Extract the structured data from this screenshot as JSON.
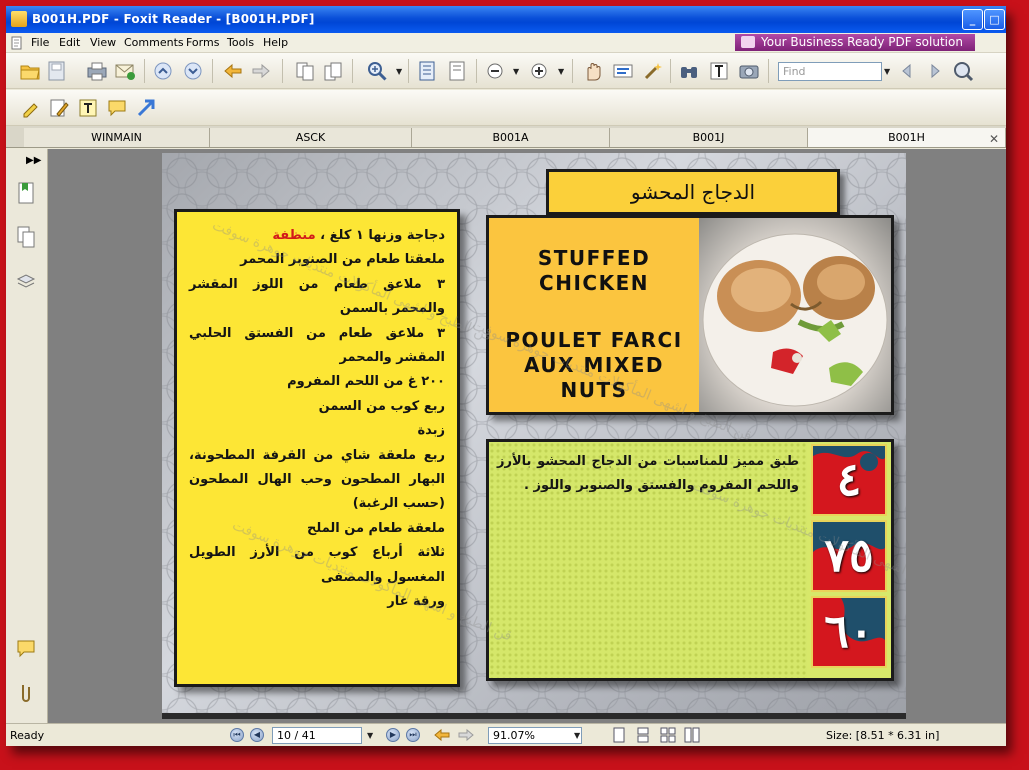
{
  "window": {
    "title": "B001H.PDF - Foxit Reader - [B001H.PDF]",
    "min_glyph": "_",
    "max_glyph": "□"
  },
  "menu": {
    "items": [
      "File",
      "Edit",
      "View",
      "Comments",
      "Forms",
      "Tools",
      "Help"
    ],
    "banner": "Your Business Ready PDF solution"
  },
  "toolbar": {
    "find_placeholder": "Find"
  },
  "tabs": [
    {
      "label": "WINMAIN"
    },
    {
      "label": "ASCK"
    },
    {
      "label": "B001A"
    },
    {
      "label": "B001J"
    },
    {
      "label": "B001H"
    }
  ],
  "document": {
    "arabic_title": "الدجاج المحشو",
    "english_title_1": "STUFFED",
    "english_title_2": "CHICKEN",
    "french_title_1": "POULET FARCI",
    "french_title_2": "AUX MIXED NUTS",
    "ingredients": [
      {
        "text": "دجاجة وزنها ١ كلغ ،",
        "highlight": "منظفة"
      },
      {
        "text": "ملعقتا طعام من الصنوبر المحمر",
        "highlight": ""
      },
      {
        "text": "٣ ملاعق طعام من اللوز المقشر والمحمر بالسمن",
        "highlight": ""
      },
      {
        "text": "٣ ملاعق طعام من الفستق الحلبي المقشر والمحمر",
        "highlight": ""
      },
      {
        "text": "٢٠٠ غ من اللحم المفروم",
        "highlight": ""
      },
      {
        "text": "ربع كوب من السمن",
        "highlight": ""
      },
      {
        "text": "زبدة",
        "highlight": ""
      },
      {
        "text": "ربع ملعقة شاي من القرفة المطحونة، البهار المطحون وحب الهال المطحون (حسب الرغبة)",
        "highlight": ""
      },
      {
        "text": "ملعقة طعام من الملح",
        "highlight": ""
      },
      {
        "text": "ثلاثة أرباع كوب من الأرز الطويل المغسول والمصفى",
        "highlight": ""
      },
      {
        "text": "ورقة غار",
        "highlight": ""
      }
    ],
    "description": "طبق مميز للمناسبات من الدجاج المحشو بالأرز واللحم المفروم والفستق والصنوبر واللوز .",
    "numbers": [
      "٤",
      "٧٥",
      "٦٠"
    ],
    "watermark": "قن الطبخ و اشهى المأكولات منتديات جوهرة سوفت"
  },
  "status": {
    "ready": "Ready",
    "page_indicator": "10 / 41",
    "zoom": "91.07%",
    "size": "Size: [8.51 * 6.31 in]"
  },
  "colors": {
    "recipe_panel": "#fde635",
    "title_box": "#fbd03a",
    "desc_panel": "#d7e86a",
    "highlight_red": "#d21a1a",
    "number_box": "#1f4f6b",
    "outer_frame": "#c8111a"
  }
}
